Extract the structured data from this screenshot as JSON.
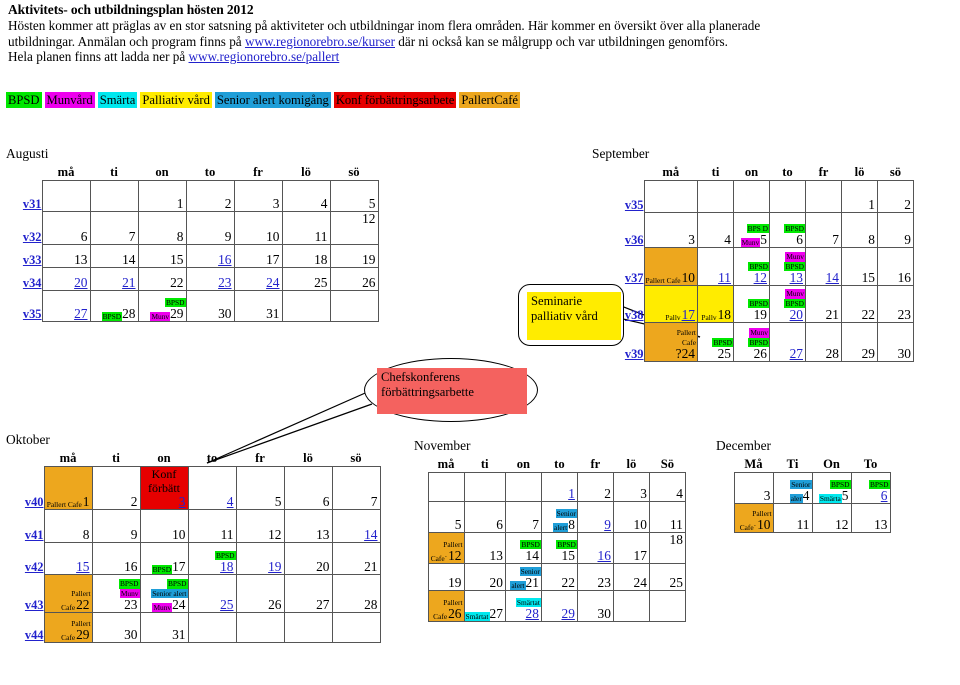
{
  "header": {
    "title": "Aktivitets- och utbildningsplan hösten 2012",
    "line1_a": "Hösten kommer att präglas av en stor satsning på aktiviteter och utbildningar inom flera områden. Här kommer en översikt över alla planerade",
    "line2_a": "utbildningar. Anmälan och program finns på ",
    "line2_link": "www.regionorebro.se/kurser",
    "line2_b": " där ni också kan se målgrupp och var utbildningen genomförs.",
    "line3_a": "Hela planen finns att ladda ner på ",
    "line3_link": "www.regionorebro.se/pallert"
  },
  "legend": [
    {
      "label": "BPSD",
      "bg": "#00e800",
      "fg": "#000000"
    },
    {
      "label": "Munvård",
      "bg": "#ee00ee",
      "fg": "#000000"
    },
    {
      "label": "Smärta",
      "bg": "#00e8ee",
      "fg": "#000000"
    },
    {
      "label": "Palliativ vård",
      "bg": "#ffec00",
      "fg": "#000000"
    },
    {
      "label": "Senior alert komigång",
      "bg": "#1f9ed8",
      "fg": "#000000"
    },
    {
      "label": "Konf förbättringsarbete",
      "bg": "#e60000",
      "fg": "#000000"
    },
    {
      "label": "PallertCafé",
      "bg": "#eda71e",
      "fg": "#000000"
    }
  ],
  "colors": {
    "bpsd": "#00e800",
    "munvard": "#ee00ee",
    "smarta": "#00e8ee",
    "palliativ": "#ffec00",
    "senior": "#1f9ed8",
    "konf": "#e60000",
    "cafe": "#eda71e",
    "link": "#2222cc",
    "border": "#555555"
  },
  "dow": {
    "lower": [
      "må",
      "ti",
      "on",
      "to",
      "fr",
      "lö",
      "sö"
    ],
    "november": [
      "må",
      "ti",
      "on",
      "to",
      "fr",
      "lö",
      "Sö"
    ],
    "december": [
      "Må",
      "Ti",
      "On",
      "To"
    ]
  },
  "months": {
    "augusti": {
      "name": "Augusti",
      "weeks": [
        "v31",
        "v32",
        "v33",
        "v34",
        "v35"
      ],
      "rows": [
        [
          {
            "n": ""
          },
          {
            "n": ""
          },
          {
            "n": "1"
          },
          {
            "n": "2"
          },
          {
            "n": "3"
          },
          {
            "n": "4"
          },
          {
            "n": "5"
          }
        ],
        [
          {
            "n": "6"
          },
          {
            "n": "7"
          },
          {
            "n": "8"
          },
          {
            "n": "9"
          },
          {
            "n": "10"
          },
          {
            "n": "11"
          },
          {
            "n": "12",
            "top": true
          }
        ],
        [
          {
            "n": "13"
          },
          {
            "n": "14"
          },
          {
            "n": "15"
          },
          {
            "n": "16",
            "u": true
          },
          {
            "n": "17"
          },
          {
            "n": "18"
          },
          {
            "n": "19"
          }
        ],
        [
          {
            "n": "20",
            "u": true
          },
          {
            "n": "21",
            "u": true
          },
          {
            "n": "22"
          },
          {
            "n": "23",
            "u": true
          },
          {
            "n": "24",
            "u": true
          },
          {
            "n": "25"
          },
          {
            "n": "26"
          }
        ],
        [
          {
            "n": "27",
            "u": true
          },
          {
            "n": "28",
            "inline": [
              {
                "t": "BPSD",
                "c": "bpsd"
              }
            ]
          },
          {
            "n": "29",
            "stack": [
              {
                "t": "BPSD",
                "c": "bpsd"
              }
            ],
            "inline": [
              {
                "t": "Munv",
                "c": "munvard"
              }
            ]
          },
          {
            "n": "30"
          },
          {
            "n": "31"
          },
          {
            "n": ""
          },
          {
            "n": ""
          }
        ]
      ]
    },
    "september": {
      "name": "September",
      "weeks": [
        "v35",
        "v36",
        "v37",
        "v38",
        "v39"
      ],
      "rows": [
        [
          {
            "n": ""
          },
          {
            "n": ""
          },
          {
            "n": ""
          },
          {
            "n": ""
          },
          {
            "n": ""
          },
          {
            "n": "1"
          },
          {
            "n": "2"
          }
        ],
        [
          {
            "n": "3"
          },
          {
            "n": "4"
          },
          {
            "n": "5",
            "stack": [
              {
                "t": "BPS D",
                "c": "bpsd"
              }
            ],
            "inline": [
              {
                "t": "Munv",
                "c": "munvard"
              }
            ]
          },
          {
            "n": "6",
            "stack": [
              {
                "t": "BPSD",
                "c": "bpsd"
              }
            ]
          },
          {
            "n": "7"
          },
          {
            "n": "8"
          },
          {
            "n": "9"
          }
        ],
        [
          {
            "n": "10",
            "cellbg": "cafe",
            "inline": [
              {
                "t": "Pallert\nCafe",
                "c": "none"
              }
            ]
          },
          {
            "n": "11",
            "u": true
          },
          {
            "n": "12",
            "u": true,
            "stack": [
              {
                "t": "BPSD",
                "c": "bpsd"
              }
            ]
          },
          {
            "n": "13",
            "u": true,
            "stack": [
              {
                "t": "Munv",
                "c": "munvard"
              },
              {
                "t": "BPSD",
                "c": "bpsd"
              }
            ]
          },
          {
            "n": "14",
            "u": true
          },
          {
            "n": "15"
          },
          {
            "n": "16"
          }
        ],
        [
          {
            "n": "17",
            "u": true,
            "cellbg": "palliativ",
            "inline": [
              {
                "t": "Pallv",
                "c": "none"
              }
            ]
          },
          {
            "n": "18",
            "cellbg": "palliativ",
            "inline": [
              {
                "t": "Pallv",
                "c": "none"
              }
            ]
          },
          {
            "n": "19",
            "stack": [
              {
                "t": "BPSD",
                "c": "bpsd"
              }
            ]
          },
          {
            "n": "20",
            "u": true,
            "stack": [
              {
                "t": "Munv",
                "c": "munvard"
              },
              {
                "t": "BPSD",
                "c": "bpsd"
              }
            ]
          },
          {
            "n": "21"
          },
          {
            "n": "22"
          },
          {
            "n": "23"
          }
        ],
        [
          {
            "n": "?24",
            "cellbg": "cafe",
            "stack": [
              {
                "t": "Pallert",
                "c": "none"
              },
              {
                "t": "Cafe",
                "c": "none"
              }
            ]
          },
          {
            "n": "25",
            "stack": [
              {
                "t": "BPSD",
                "c": "bpsd"
              }
            ]
          },
          {
            "n": "26",
            "stack": [
              {
                "t": "Munv",
                "c": "munvard"
              },
              {
                "t": "BPSD",
                "c": "bpsd"
              }
            ]
          },
          {
            "n": "27",
            "u": true
          },
          {
            "n": "28"
          },
          {
            "n": "29"
          },
          {
            "n": "30"
          }
        ]
      ]
    },
    "oktober": {
      "name": "Oktober",
      "weeks": [
        "v40",
        "v41",
        "v42",
        "v43",
        "v44"
      ],
      "rows": [
        [
          {
            "n": "1",
            "cellbg": "cafe",
            "inline": [
              {
                "t": "Pallert\nCafe",
                "c": "none"
              }
            ]
          },
          {
            "n": "2"
          },
          {
            "n": "3",
            "u": true,
            "cellbg": "konf",
            "bigstack": [
              "Konf",
              "förbätt"
            ]
          },
          {
            "n": "4",
            "u": true
          },
          {
            "n": "5"
          },
          {
            "n": "6"
          },
          {
            "n": "7"
          }
        ],
        [
          {
            "n": "8",
            "low": true
          },
          {
            "n": "9"
          },
          {
            "n": "10"
          },
          {
            "n": "11"
          },
          {
            "n": "12"
          },
          {
            "n": "13"
          },
          {
            "n": "14",
            "u": true
          }
        ],
        [
          {
            "n": "15",
            "u": true
          },
          {
            "n": "16"
          },
          {
            "n": "17",
            "inline": [
              {
                "t": "BPSD",
                "c": "bpsd"
              }
            ]
          },
          {
            "n": "18",
            "u": true,
            "stack": [
              {
                "t": "BPSD",
                "c": "bpsd"
              }
            ]
          },
          {
            "n": "19",
            "u": true
          },
          {
            "n": "20"
          },
          {
            "n": "21"
          }
        ],
        [
          {
            "n": "22",
            "cellbg": "cafe",
            "stack": [
              {
                "t": "Pallert",
                "c": "none"
              }
            ],
            "inline": [
              {
                "t": "Cafe",
                "c": "none"
              }
            ]
          },
          {
            "n": "23",
            "stack": [
              {
                "t": "BPSD",
                "c": "bpsd"
              },
              {
                "t": "Munv",
                "c": "munvard"
              }
            ]
          },
          {
            "n": "24",
            "stack": [
              {
                "t": "BPSD",
                "c": "bpsd"
              },
              {
                "t": "Senior alert",
                "c": "senior"
              }
            ],
            "inline": [
              {
                "t": "Munv",
                "c": "munvard"
              }
            ]
          },
          {
            "n": "25",
            "u": true
          },
          {
            "n": "26"
          },
          {
            "n": "27"
          },
          {
            "n": "28"
          }
        ],
        [
          {
            "n": "29",
            "cellbg": "cafe",
            "stack": [
              {
                "t": "Pallert",
                "c": "none"
              }
            ],
            "inline": [
              {
                "t": "Cafe",
                "c": "none"
              }
            ]
          },
          {
            "n": "30"
          },
          {
            "n": "31"
          },
          {
            "n": ""
          },
          {
            "n": ""
          },
          {
            "n": ""
          },
          {
            "n": ""
          }
        ]
      ]
    },
    "november": {
      "name": "November",
      "weeks": [
        "",
        "",
        "",
        "",
        ""
      ],
      "rows": [
        [
          {
            "n": ""
          },
          {
            "n": ""
          },
          {
            "n": ""
          },
          {
            "n": "1",
            "u": true
          },
          {
            "n": "2"
          },
          {
            "n": "3"
          },
          {
            "n": "4"
          }
        ],
        [
          {
            "n": "5"
          },
          {
            "n": "6"
          },
          {
            "n": "7"
          },
          {
            "n": "8",
            "stack": [
              {
                "t": "Senior",
                "c": "senior"
              }
            ],
            "inline": [
              {
                "t": "alert",
                "c": "senior"
              }
            ]
          },
          {
            "n": "9",
            "u": true
          },
          {
            "n": "10"
          },
          {
            "n": "11"
          }
        ],
        [
          {
            "n": "12",
            "cellbg": "cafe",
            "stack": [
              {
                "t": "Pallert",
                "c": "none"
              }
            ],
            "inline": [
              {
                "t": "Cafe´",
                "c": "none"
              }
            ]
          },
          {
            "n": "13"
          },
          {
            "n": "14",
            "stack": [
              {
                "t": "BPSD",
                "c": "bpsd"
              }
            ]
          },
          {
            "n": "15",
            "stack": [
              {
                "t": "BPSD",
                "c": "bpsd"
              }
            ]
          },
          {
            "n": "16",
            "u": true
          },
          {
            "n": "17"
          },
          {
            "n": "18",
            "top": true
          }
        ],
        [
          {
            "n": "19"
          },
          {
            "n": "20"
          },
          {
            "n": "21",
            "stack": [
              {
                "t": "Senior",
                "c": "senior"
              }
            ],
            "inline": [
              {
                "t": "alert",
                "c": "senior"
              }
            ]
          },
          {
            "n": "22"
          },
          {
            "n": "23"
          },
          {
            "n": "24"
          },
          {
            "n": "25"
          }
        ],
        [
          {
            "n": "26",
            "cellbg": "cafe",
            "stack": [
              {
                "t": "Pallert",
                "c": "none"
              }
            ],
            "inline": [
              {
                "t": "Cafe",
                "c": "none"
              }
            ]
          },
          {
            "n": "27",
            "inline": [
              {
                "t": "Smärtat",
                "c": "smarta"
              }
            ]
          },
          {
            "n": "28",
            "u": true,
            "stack": [
              {
                "t": "Smärtat",
                "c": "smarta"
              }
            ]
          },
          {
            "n": "29",
            "u": true
          },
          {
            "n": "30"
          },
          {
            "n": ""
          },
          {
            "n": ""
          }
        ]
      ]
    },
    "december": {
      "name": "December",
      "weeks": [
        "",
        ""
      ],
      "rows": [
        [
          {
            "n": "3"
          },
          {
            "n": "4",
            "stack": [
              {
                "t": "Senior",
                "c": "senior"
              }
            ],
            "inline": [
              {
                "t": "aler",
                "c": "senior"
              }
            ]
          },
          {
            "n": "5",
            "stack": [
              {
                "t": "BPSD",
                "c": "bpsd"
              }
            ],
            "inline": [
              {
                "t": "Smärta",
                "c": "smarta"
              }
            ]
          },
          {
            "n": "6",
            "u": true,
            "stack": [
              {
                "t": "BPSD",
                "c": "bpsd"
              }
            ]
          }
        ],
        [
          {
            "n": "10",
            "cellbg": "cafe",
            "stack": [
              {
                "t": "Pallert",
                "c": "none"
              }
            ],
            "inline": [
              {
                "t": "Cafe´",
                "c": "none"
              }
            ]
          },
          {
            "n": "11"
          },
          {
            "n": "12"
          },
          {
            "n": "13"
          }
        ]
      ]
    }
  },
  "callouts": [
    {
      "id": "seminarie",
      "line1": "Seminarie",
      "line2": "palliativ vård",
      "bg": "#ffec00"
    },
    {
      "id": "chefskonferens",
      "line1": "Chefskonferens",
      "line2": "förbättringsarbette",
      "bg": "#f4625f"
    }
  ]
}
